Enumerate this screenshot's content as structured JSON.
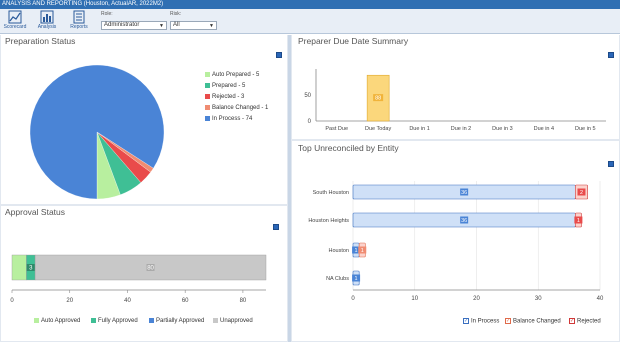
{
  "window": {
    "title": "ANALYSIS AND REPORTING  (Houston, ActualAR, 2022M2)"
  },
  "toolbar": {
    "buttons": [
      {
        "label": "Scorecard",
        "icon": "scorecard-icon"
      },
      {
        "label": "Analysis",
        "icon": "analysis-icon"
      },
      {
        "label": "Reports",
        "icon": "reports-icon"
      }
    ],
    "role_label": "Role:",
    "role_value": "Administrator",
    "risk_label": "Risk:",
    "risk_value": "All"
  },
  "colors": {
    "auto_prepared": "#b8ef9f",
    "prepared": "#3fbf95",
    "rejected": "#e94b4b",
    "balance_changed": "#f08c72",
    "in_process": "#4a84d6",
    "auto_approved": "#b8ef9f",
    "fully_approved": "#3fbf95",
    "partially_approved": "#4a84d6",
    "unapproved": "#c8c8c8",
    "due_today": "#fbd77c",
    "accent": "#2f6fb3"
  },
  "preparation_status": {
    "title": "Preparation Status",
    "legend": [
      "Auto Prepared - 5",
      "Prepared - 5",
      "Rejected - 3",
      "Balance Changed - 1",
      "In Process - 74"
    ]
  },
  "approval_status": {
    "title": "Approval Status",
    "legend": [
      "Auto Approved",
      "Fully Approved",
      "Partially Approved",
      "Unapproved"
    ]
  },
  "due_summary": {
    "title": "Preparer Due Date Summary"
  },
  "unreconciled": {
    "title": "Top Unreconciled by Entity",
    "legend": [
      "In Process",
      "Balance Changed",
      "Rejected"
    ]
  },
  "chart_data": [
    {
      "type": "pie",
      "title": "Preparation Status",
      "categories": [
        "Auto Prepared",
        "Prepared",
        "Rejected",
        "Balance Changed",
        "In Process"
      ],
      "values": [
        5,
        5,
        3,
        1,
        74
      ]
    },
    {
      "type": "bar",
      "orientation": "horizontal",
      "stacked": true,
      "title": "Approval Status",
      "series": [
        {
          "name": "Auto Approved",
          "values": [
            5
          ]
        },
        {
          "name": "Fully Approved",
          "values": [
            3
          ]
        },
        {
          "name": "Partially Approved",
          "values": [
            0
          ]
        },
        {
          "name": "Unapproved",
          "values": [
            80
          ]
        }
      ],
      "data_labels": [
        "",
        "3",
        "",
        "80"
      ],
      "xlim": [
        0,
        88
      ],
      "xticks": [
        0,
        20,
        40,
        60,
        80
      ],
      "grid": false
    },
    {
      "type": "bar",
      "title": "Preparer Due Date Summary",
      "categories": [
        "Past Due",
        "Due Today",
        "Due in 1",
        "Due in 2",
        "Due in 3",
        "Due in 4",
        "Due in 5"
      ],
      "values": [
        0,
        88,
        0,
        0,
        0,
        0,
        0
      ],
      "data_labels": [
        "",
        "88",
        "",
        "",
        "",
        "",
        ""
      ],
      "ylim": [
        0,
        100
      ],
      "yticks": [
        0,
        50
      ],
      "grid": false
    },
    {
      "type": "bar",
      "orientation": "horizontal",
      "stacked": true,
      "title": "Top Unreconciled by Entity",
      "categories": [
        "South Houston",
        "Houston Heights",
        "Houston",
        "NA Clubs"
      ],
      "series": [
        {
          "name": "In Process",
          "values": [
            36,
            36,
            1,
            1
          ],
          "labels": [
            "36",
            "36",
            "1",
            "1"
          ]
        },
        {
          "name": "Balance Changed",
          "values": [
            0,
            0,
            1,
            0
          ],
          "labels": [
            "",
            "",
            "1",
            ""
          ]
        },
        {
          "name": "Rejected",
          "values": [
            2,
            1,
            0,
            0
          ],
          "labels": [
            "2",
            "1",
            "",
            ""
          ]
        }
      ],
      "xlim": [
        0,
        40
      ],
      "xticks": [
        0,
        10,
        20,
        30,
        40
      ],
      "grid": true
    }
  ]
}
